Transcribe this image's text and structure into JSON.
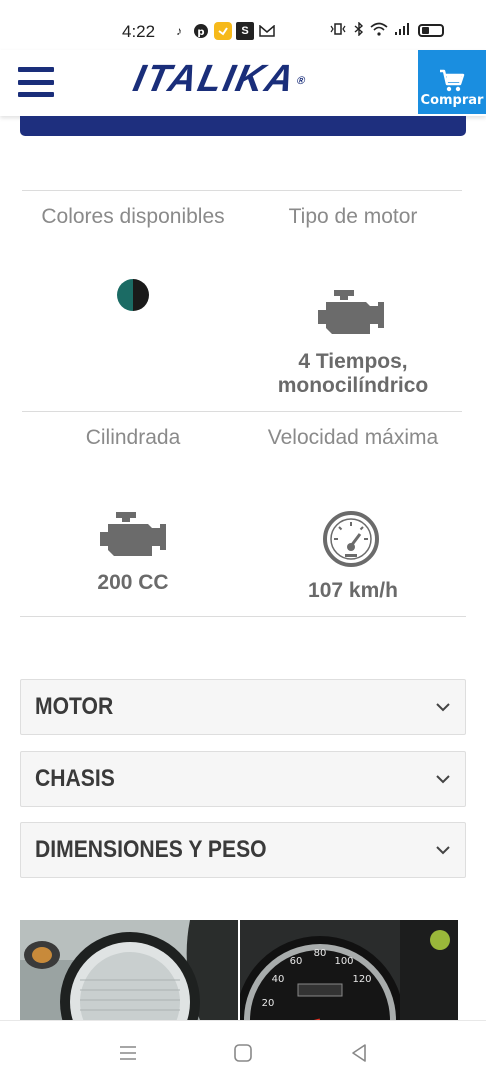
{
  "status_bar": {
    "time": "4:22"
  },
  "header": {
    "logo_text": "ITALIKA",
    "logo_mark": "®",
    "cart_label": "Comprar",
    "brand_color": "#1a2e7a",
    "cart_color": "#1a8ee0"
  },
  "specs": {
    "colors_label": "Colores disponibles",
    "colors": [
      "#1b6b64",
      "#1a1a1a"
    ],
    "engine_type_label": "Tipo de motor",
    "engine_type_value_1": "4 Tiempos,",
    "engine_type_value_2": "monocilíndrico",
    "displacement_label": "Cilindrada",
    "displacement_value": "200 CC",
    "top_speed_label": "Velocidad máxima",
    "top_speed_value": "107 km/h"
  },
  "accordions": [
    {
      "title": "MOTOR"
    },
    {
      "title": "CHASIS"
    },
    {
      "title": "DIMENSIONES Y PESO"
    }
  ],
  "icons": {
    "engine": "engine-icon",
    "speedometer": "speedometer-icon",
    "chevron": "chevron-down-icon"
  }
}
